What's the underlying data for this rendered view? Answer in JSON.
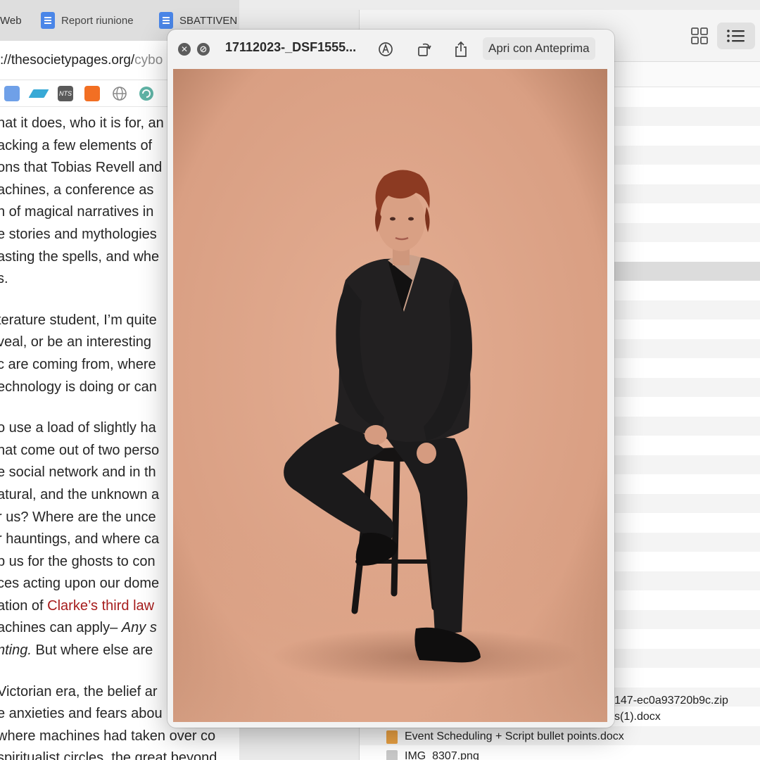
{
  "browser": {
    "tabs": [
      {
        "label": "Web"
      },
      {
        "label": "Report riunione"
      },
      {
        "label": "SBATTIVEN"
      }
    ],
    "url": {
      "main": "://thesocietypages.org/",
      "rest": "cybo"
    },
    "bookmark_icons": [
      "doc-icon",
      "parallelogram-icon",
      "nts-icon",
      "soundcloud-icon",
      "globe-icon",
      "refresh-globe-icon"
    ],
    "article": {
      "lines": [
        "hat it does, who it is for, an",
        "acking a few elements of",
        "ons that Tobias Revell and",
        "achines, a conference as",
        "n of magical narratives in",
        "e stories and mythologies",
        "asting the spells, and whe",
        "s.",
        "",
        "terature student, I’m quite",
        "veal, or be an interesting",
        "c are coming from, where",
        "echnology is doing or can",
        "",
        "o use a load of slightly ha",
        "hat come out of two perso",
        "e social network and in th",
        "atural, and the unknown a",
        "r us?  Where are the unce",
        "r hauntings, and where ca",
        "p us for the ghosts to con",
        "ces acting upon our dome",
        "ation of ",
        "achines can apply– ",
        "nting.",
        "",
        "Victorian era, the belief ar",
        "e anxieties and fears abou",
        "where machines had taken over co",
        "spiritualist circles, the great beyond"
      ],
      "link_text": "Clarke’s third law",
      "italic_any": "Any s",
      "after_nting": " But where else are"
    }
  },
  "finder": {
    "files": [
      {
        "name": "147-ec0a93720b9c.zip",
        "type": "zip"
      },
      {
        "name": "s(1).docx",
        "type": "docx"
      },
      {
        "name": "Event Scheduling + Script bullet points.docx",
        "type": "docx"
      },
      {
        "name": "IMG_8307.png",
        "type": "png"
      }
    ]
  },
  "quicklook": {
    "close_glyph": "✕",
    "fullscreen_glyph": "⊘",
    "title": "17112023-_DSF1555...",
    "open_button": "Apri con Anteprima",
    "tools": [
      "markup-icon",
      "rotate-icon",
      "share-icon"
    ],
    "photo": {
      "background_color": "#dfa88c",
      "subject": "person with short auburn hair in a black oversized suit seated on a tall black wooden stool"
    }
  },
  "colors": {
    "backdrop": "#dfa88c",
    "suit": "#1e1c1c",
    "hair": "#8c3a22",
    "skin": "#d89a7e",
    "link": "#a61c1c",
    "doc_blue": "#4a86e8"
  }
}
